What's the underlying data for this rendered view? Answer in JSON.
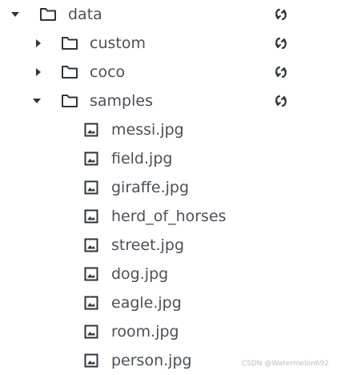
{
  "tree": {
    "root": {
      "label": "data",
      "expanded": true,
      "icon": "folder-icon",
      "action_icon": "refresh-icon"
    },
    "folders": [
      {
        "label": "custom",
        "expanded": false,
        "icon": "folder-icon",
        "action_icon": "refresh-icon"
      },
      {
        "label": "coco",
        "expanded": false,
        "icon": "folder-icon",
        "action_icon": "refresh-icon"
      },
      {
        "label": "samples",
        "expanded": true,
        "icon": "folder-icon",
        "action_icon": "refresh-icon"
      }
    ],
    "files": [
      {
        "label": "messi.jpg",
        "icon": "image-icon"
      },
      {
        "label": "field.jpg",
        "icon": "image-icon"
      },
      {
        "label": "giraffe.jpg",
        "icon": "image-icon"
      },
      {
        "label": "herd_of_horses",
        "icon": "image-icon"
      },
      {
        "label": "street.jpg",
        "icon": "image-icon"
      },
      {
        "label": "dog.jpg",
        "icon": "image-icon"
      },
      {
        "label": "eagle.jpg",
        "icon": "image-icon"
      },
      {
        "label": "room.jpg",
        "icon": "image-icon"
      },
      {
        "label": "person.jpg",
        "icon": "image-icon"
      }
    ]
  },
  "watermark": "CSDN @Watermelon692",
  "colors": {
    "text": "#4a5059",
    "icon": "#2f353d",
    "watermark": "#b9bec6"
  }
}
